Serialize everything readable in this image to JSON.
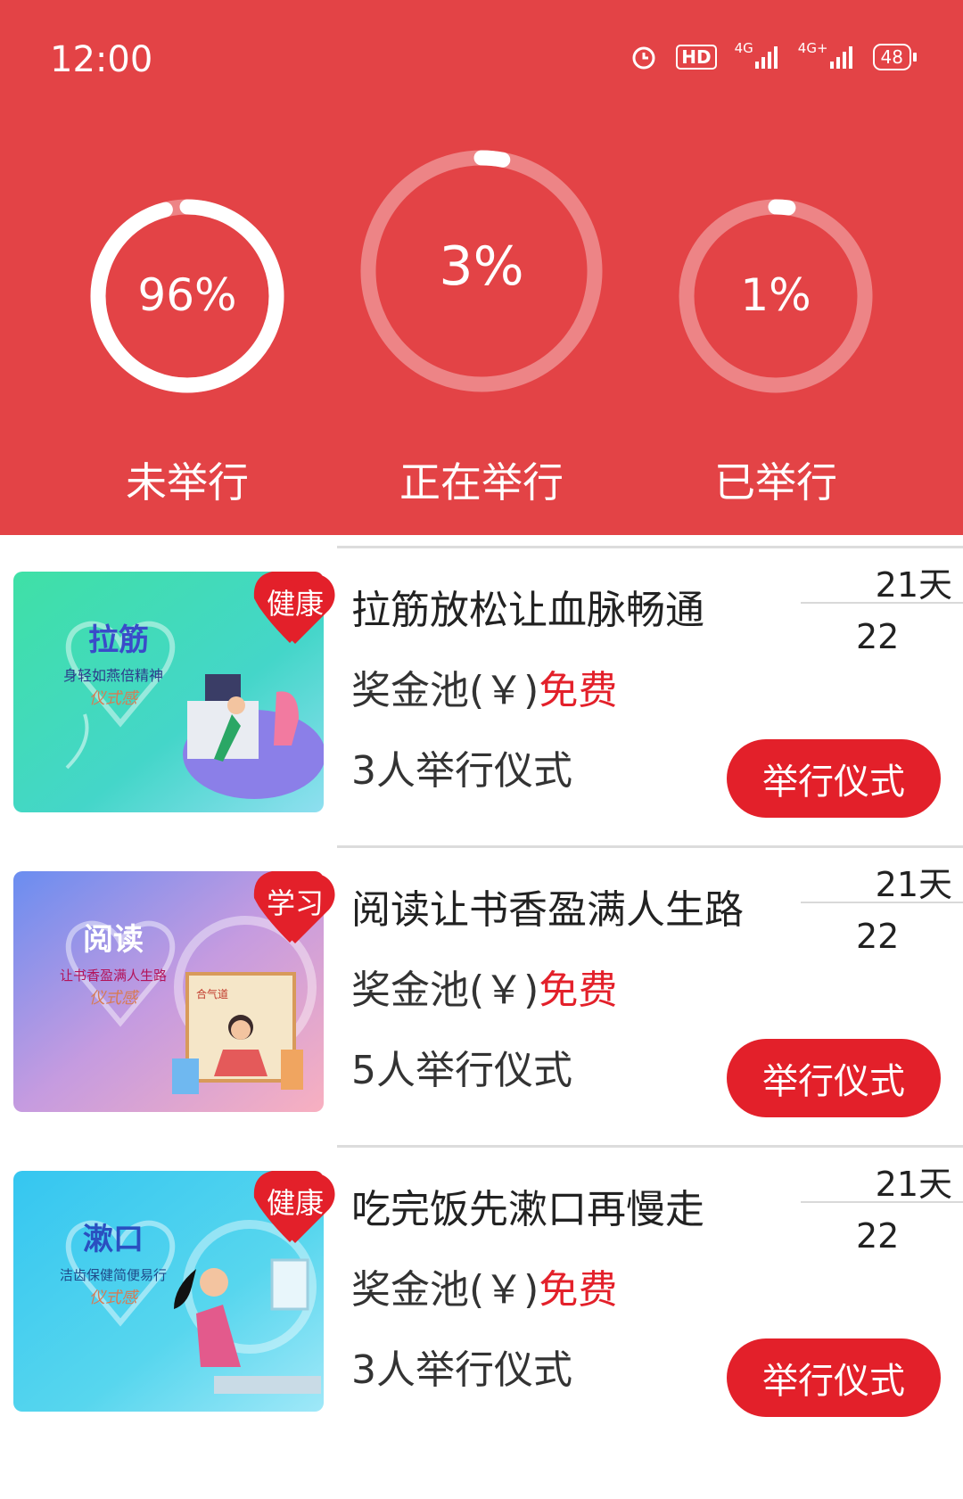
{
  "status_bar": {
    "time": "12:00",
    "icons": [
      "alarm-icon",
      "hd-icon",
      "signal-4g-icon",
      "signal-4g-plus-icon",
      "battery-icon"
    ],
    "hd_label": "HD",
    "net1_label": "4G",
    "net2_label": "4G+",
    "battery_label": "48"
  },
  "stats": [
    {
      "value_text": "96%",
      "label": "未举行",
      "fraction": 0.96
    },
    {
      "value_text": "3%",
      "label": "正在举行",
      "fraction": 0.03
    },
    {
      "value_text": "1%",
      "label": "已举行",
      "fraction": 0.01
    }
  ],
  "colors": {
    "header_bg": "#e34346",
    "accent_red": "#e3202a"
  },
  "items": [
    {
      "title": "拉筋放松让血脉畅通",
      "tag": "健康",
      "days": "21天",
      "count": "22",
      "pool_label": "奖金池(￥)",
      "pool_value": "免费",
      "people": "3人举行仪式",
      "button": "举行仪式",
      "thumb": {
        "title": "拉筋",
        "subtitle": "身轻如燕倍精神",
        "caption": "仪式感"
      }
    },
    {
      "title": "阅读让书香盈满人生路",
      "tag": "学习",
      "days": "21天",
      "count": "22",
      "pool_label": "奖金池(￥)",
      "pool_value": "免费",
      "people": "5人举行仪式",
      "button": "举行仪式",
      "thumb": {
        "title": "阅读",
        "subtitle": "让书香盈满人生路",
        "caption": "仪式感",
        "extra": "合气道"
      }
    },
    {
      "title": "吃完饭先漱口再慢走",
      "tag": "健康",
      "days": "21天",
      "count": "22",
      "pool_label": "奖金池(￥)",
      "pool_value": "免费",
      "people": "3人举行仪式",
      "button": "举行仪式",
      "thumb": {
        "title": "漱口",
        "subtitle": "洁齿保健简便易行",
        "caption": "仪式感"
      }
    }
  ]
}
